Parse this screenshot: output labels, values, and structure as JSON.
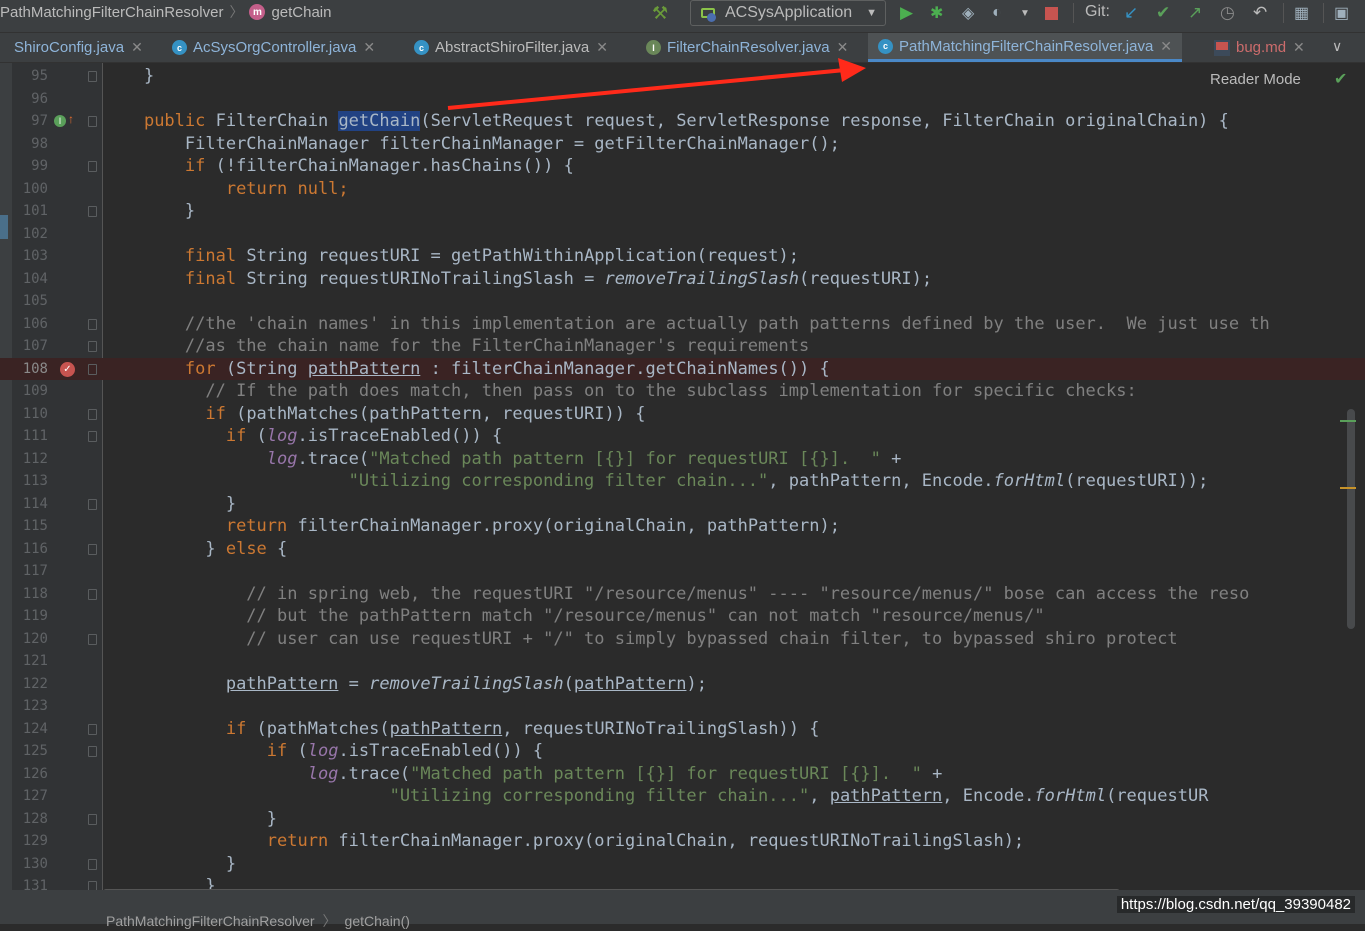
{
  "breadcrumb": {
    "class_name": "PathMatchingFilterChainResolver",
    "method_badge": "m",
    "method_name": "getChain"
  },
  "toolbar": {
    "run_config": "ACSysApplication",
    "git_label": "Git:",
    "icons": [
      "hammer-icon",
      "run-icon",
      "debug-icon",
      "coverage-icon",
      "profile-icon",
      "stop-icon",
      "git-update-icon",
      "git-commit-icon",
      "git-push-icon",
      "history-icon",
      "rollback-icon",
      "project-structure-icon",
      "run-panel-icon"
    ]
  },
  "tabs": [
    {
      "label": "ShiroConfig.java",
      "icon": "class"
    },
    {
      "label": "AcSysOrgController.java",
      "icon": "class"
    },
    {
      "label": "AbstractShiroFilter.java",
      "icon": "class"
    },
    {
      "label": "FilterChainResolver.java",
      "icon": "interface"
    },
    {
      "label": "PathMatchingFilterChainResolver.java",
      "icon": "class",
      "active": true
    },
    {
      "label": "bug.md",
      "icon": "markdown"
    }
  ],
  "editor": {
    "reader_mode_label": "Reader Mode",
    "line_numbers": [
      "95",
      "96",
      "97",
      "98",
      "99",
      "100",
      "101",
      "102",
      "103",
      "104",
      "105",
      "106",
      "107",
      "108",
      "109",
      "110",
      "111",
      "112",
      "113",
      "114",
      "115",
      "116",
      "117",
      "118",
      "119",
      "120",
      "121",
      "122",
      "123",
      "124",
      "125",
      "126",
      "127",
      "128",
      "129",
      "130",
      "131"
    ],
    "code": {
      "l95": "}",
      "l97_public": "public ",
      "l97_type": "FilterChain ",
      "l97_method": "getChain",
      "l97_params": "(ServletRequest request, ServletResponse response, FilterChain originalChain) {",
      "l98": "FilterChainManager filterChainManager = getFilterChainManager();",
      "l99_kw": "if ",
      "l99_rest": "(!filterChainManager.hasChains()) {",
      "l100_kw": "return null",
      "l100_end": ";",
      "l101": "}",
      "l103_kw": "final ",
      "l103_rest": "String requestURI = getPathWithinApplication(request);",
      "l104_kw": "final ",
      "l104_a": "String requestURINoTrailingSlash = ",
      "l104_fn": "removeTrailingSlash",
      "l104_b": "(requestURI);",
      "l106": "//the 'chain names' in this implementation are actually path patterns defined by the user.  We just use th",
      "l107": "//as the chain name for the FilterChainManager's requirements",
      "l108_kw": "for ",
      "l108_a": "(String ",
      "l108_var": "pathPattern",
      "l108_b": " : filterChainManager.getChainNames()) {",
      "l109": "// If the path does match, then pass on to the subclass implementation for specific checks:",
      "l110_kw": "if ",
      "l110_rest": "(pathMatches(pathPattern, requestURI)) {",
      "l111_kw": "if ",
      "l111_a": "(",
      "l111_log": "log",
      "l111_b": ".isTraceEnabled()) {",
      "l112_log": "log",
      "l112_a": ".trace(",
      "l112_str": "\"Matched path pattern [{}] for requestURI [{}].  \"",
      "l112_b": " +",
      "l113_str": "\"Utilizing corresponding filter chain...\"",
      "l113_a": ", pathPattern, Encode.",
      "l113_fn": "forHtml",
      "l113_b": "(requestURI));",
      "l114": "}",
      "l115_kw": "return ",
      "l115_rest": "filterChainManager.proxy(originalChain, pathPattern);",
      "l116_a": "} ",
      "l116_kw": "else ",
      "l116_b": "{",
      "l118": "// in spring web, the requestURI \"/resource/menus\" ---- \"resource/menus/\" bose can access the reso",
      "l119": "// but the pathPattern match \"/resource/menus\" can not match \"resource/menus/\"",
      "l120": "// user can use requestURI + \"/\" to simply bypassed chain filter, to bypassed shiro protect",
      "l122_var": "pathPattern",
      "l122_a": " = ",
      "l122_fn": "removeTrailingSlash",
      "l122_b": "(",
      "l122_var2": "pathPattern",
      "l122_c": ");",
      "l124_kw": "if ",
      "l124_a": "(pathMatches(",
      "l124_var": "pathPattern",
      "l124_b": ", requestURINoTrailingSlash)) {",
      "l125_kw": "if ",
      "l125_a": "(",
      "l125_log": "log",
      "l125_b": ".isTraceEnabled()) {",
      "l126_log": "log",
      "l126_a": ".trace(",
      "l126_str": "\"Matched path pattern [{}] for requestURI [{}].  \"",
      "l126_b": " +",
      "l127_str": "\"Utilizing corresponding filter chain...\"",
      "l127_a": ", ",
      "l127_var": "pathPattern",
      "l127_b": ", Encode.",
      "l127_fn": "forHtml",
      "l127_c": "(requestUR",
      "l128": "}",
      "l129_kw": "return ",
      "l129_rest": "filterChainManager.proxy(originalChain, requestURINoTrailingSlash);",
      "l130": "}",
      "l131": "}"
    }
  },
  "status": {
    "crumb_class": "PathMatchingFilterChainResolver",
    "crumb_method": "getChain()",
    "watermark": "https://blog.csdn.net/qq_39390482"
  },
  "colors": {
    "keyword": "#cc7832",
    "string": "#6a8759",
    "comment": "#808080",
    "field": "#9876aa",
    "breakpoint": "#c75450",
    "annotation_arrow": "#ff2a1a"
  }
}
